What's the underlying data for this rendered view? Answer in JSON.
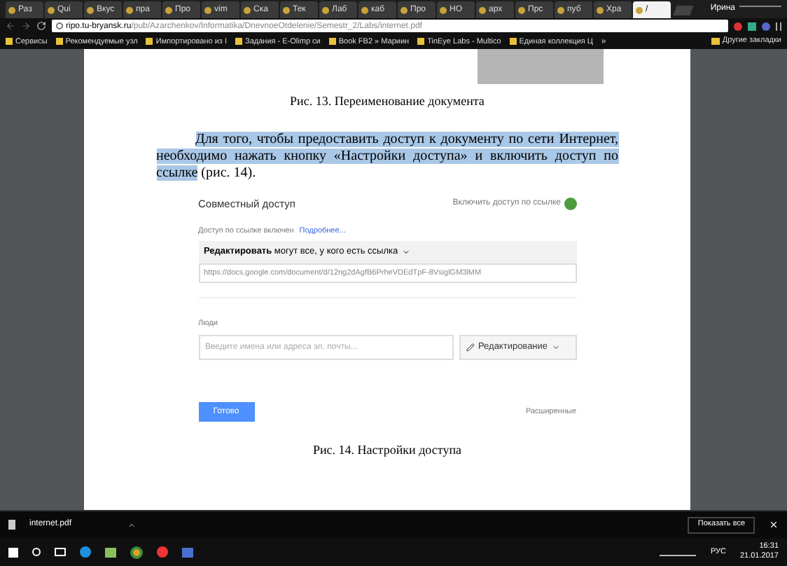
{
  "browser": {
    "tabs": [
      {
        "label": "Раз",
        "selected": false
      },
      {
        "label": "Qui",
        "selected": false
      },
      {
        "label": "Вкус",
        "selected": false
      },
      {
        "label": "пра",
        "selected": false
      },
      {
        "label": "Про",
        "selected": false
      },
      {
        "label": "vim",
        "selected": false
      },
      {
        "label": "Ска",
        "selected": false
      },
      {
        "label": "Тек",
        "selected": false
      },
      {
        "label": "Лаб",
        "selected": false
      },
      {
        "label": "каб",
        "selected": false
      },
      {
        "label": "Про",
        "selected": false
      },
      {
        "label": "НО",
        "selected": false
      },
      {
        "label": "арх",
        "selected": false
      },
      {
        "label": "Прс",
        "selected": false
      },
      {
        "label": "пуб",
        "selected": false
      },
      {
        "label": "Хра",
        "selected": false
      },
      {
        "label": "/",
        "selected": true
      }
    ],
    "user": "Ирина",
    "address": {
      "host": "ripo.tu-bryansk.ru",
      "path": "/pub/Azarchenkov/Informatika/DnevnoeOtdelenie/Semestr_2/Labs/internet.pdf"
    },
    "bookmarks": [
      "Сервисы",
      "Рекомендуемые узл",
      "Импортировано из I",
      "Задания - E-Olimp си",
      "Book FB2 » Мариин",
      "TinEye Labs - Multico",
      "Единая коллекция Ц"
    ],
    "bookmarks_more": "»",
    "other_bookmarks": "Другие закладки"
  },
  "document": {
    "caption_1": "Рис. 13. Переименование документа",
    "paragraph": [
      {
        "text": "Для того, чтобы предоставить доступ к документу по сети Интернет, необходимо нажать кнопку «Настройки доступа» и включить доступ по ссылке",
        "highlighted": true
      },
      {
        "text": " (рис. 14).",
        "highlighted": false
      }
    ],
    "dialog": {
      "title": "Совместный доступ",
      "link_toggle": "Включить доступ по ссылке",
      "link_status": "Доступ по ссылке включен",
      "more_link": "Подробнее...",
      "permission": "**Редактировать** могут все, у кого есть ссылка",
      "url": "https://docs.google.com/document/d/12ng2dAgfB6PrheVDEdTpF-8VsiglGM3lMM",
      "people_label": "Люди",
      "people_placeholder": "Введите имена или адреса эл. почты...",
      "role_button": "Редактирование",
      "done_button": "Готово",
      "advanced_link": "Расширенные"
    },
    "caption_2": "Рис. 14. Настройки доступа"
  },
  "download_bar": {
    "file": "internet.pdf",
    "show_all": "Показать все"
  },
  "taskbar": {
    "language": "РУС",
    "time": "16:31",
    "date": "21.01.2017"
  }
}
